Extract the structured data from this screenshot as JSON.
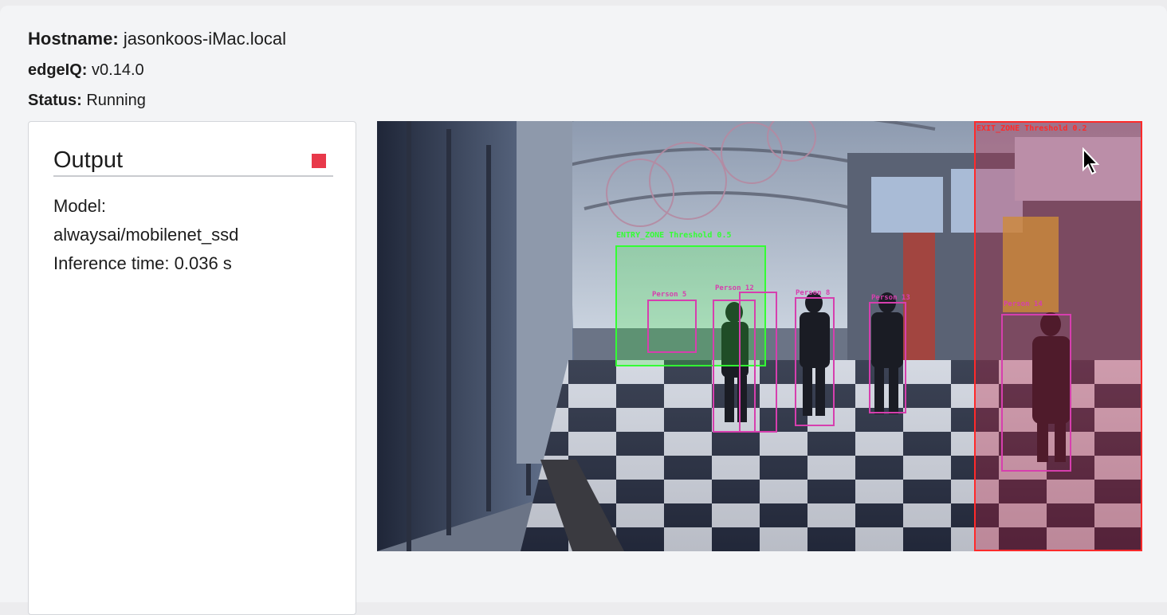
{
  "info": {
    "hostname_label": "Hostname:",
    "hostname_value": "jasonkoos-iMac.local",
    "edgeiq_label": "edgeIQ:",
    "edgeiq_value": "v0.14.0",
    "status_label": "Status:",
    "status_value": "Running"
  },
  "output": {
    "title": "Output",
    "model_label": "Model:",
    "model_value": "alwaysai/mobilenet_ssd",
    "inference_text": "Inference time: 0.036 s",
    "stop_color": "#e8394a"
  },
  "video": {
    "zones": [
      {
        "label": "ENTRY_ZONE  Threshold 0.5",
        "color": "#33ff33"
      },
      {
        "label": "EXIT_ZONE  Threshold 0.2",
        "color": "#ff2a2a"
      }
    ],
    "detections": [
      {
        "label": "Person 12"
      },
      {
        "label": "Person 8"
      },
      {
        "label": "Person 13"
      },
      {
        "label": "Person 14"
      },
      {
        "label": "Person 5"
      }
    ],
    "detection_color": "#d63fae"
  },
  "icons": {
    "cursor": "mouse-pointer-icon",
    "stop": "stop-square-icon"
  }
}
